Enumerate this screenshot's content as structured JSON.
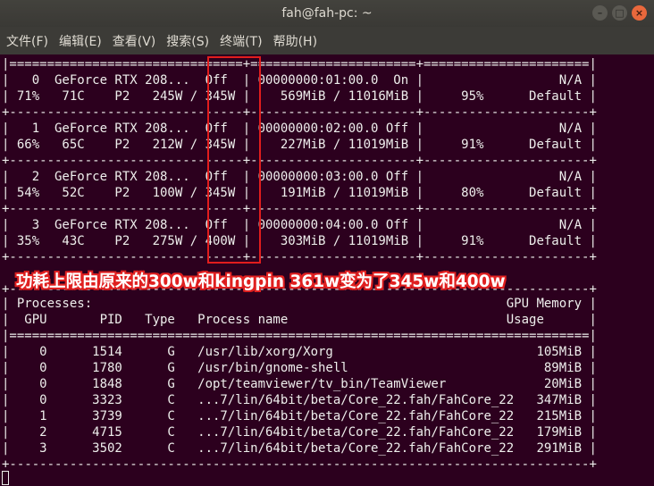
{
  "window": {
    "title": "fah@fah-pc: ~"
  },
  "menu": [
    "文件(F)",
    "编辑(E)",
    "查看(V)",
    "搜索(S)",
    "终端(T)",
    "帮助(H)"
  ],
  "terminal_lines": [
    "|===============================+======================+======================|",
    "|   0  GeForce RTX 208...  Off  | 00000000:01:00.0  On |                  N/A |",
    "| 71%   71C    P2   245W / 345W |    569MiB / 11016MiB |     95%      Default |",
    "+-------------------------------+----------------------+----------------------+",
    "|   1  GeForce RTX 208...  Off  | 00000000:02:00.0 Off |                  N/A |",
    "| 66%   65C    P2   212W / 345W |    227MiB / 11019MiB |     91%      Default |",
    "+-------------------------------+----------------------+----------------------+",
    "|   2  GeForce RTX 208...  Off  | 00000000:03:00.0 Off |                  N/A |",
    "| 54%   52C    P2   100W / 345W |    191MiB / 11019MiB |     80%      Default |",
    "+-------------------------------+----------------------+----------------------+",
    "|   3  GeForce RTX 208...  Off  | 00000000:04:00.0 Off |                  N/A |",
    "| 35%   43C    P2   275W / 400W |    303MiB / 11019MiB |     91%      Default |",
    "+-------------------------------+----------------------+----------------------+",
    "",
    "+-----------------------------------------------------------------------------+",
    "| Processes:                                                       GPU Memory |",
    "|  GPU       PID   Type   Process name                             Usage      |",
    "|=============================================================================|",
    "|    0      1514      G   /usr/lib/xorg/Xorg                           105MiB |",
    "|    0      1780      G   /usr/bin/gnome-shell                          89MiB |",
    "|    0      1848      G   /opt/teamviewer/tv_bin/TeamViewer             20MiB |",
    "|    0      3323      C   ...7/lin/64bit/beta/Core_22.fah/FahCore_22   347MiB |",
    "|    1      3739      C   ...7/lin/64bit/beta/Core_22.fah/FahCore_22   215MiB |",
    "|    2      4715      C   ...7/lin/64bit/beta/Core_22.fah/FahCore_22   179MiB |",
    "|    3      3502      C   ...7/lin/64bit/beta/Core_22.fah/FahCore_22   291MiB |",
    "+-----------------------------------------------------------------------------+"
  ],
  "annotation": "功耗上限由原来的300w和kingpin 361w变为了345w和400w",
  "colors": {
    "terminal_bg": "#2c001e",
    "highlight": "#e11d1d",
    "annotation_outline": "#e02020"
  }
}
